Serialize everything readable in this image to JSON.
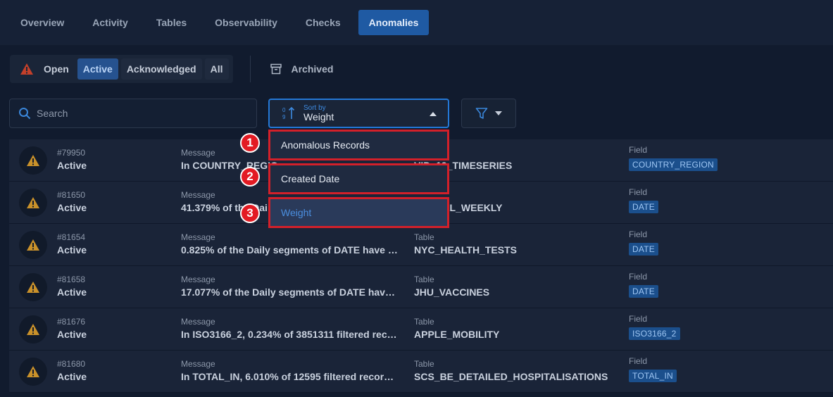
{
  "nav": {
    "tabs": [
      {
        "label": "Overview"
      },
      {
        "label": "Activity"
      },
      {
        "label": "Tables"
      },
      {
        "label": "Observability"
      },
      {
        "label": "Checks"
      },
      {
        "label": "Anomalies"
      }
    ],
    "active_tab": "Anomalies"
  },
  "filters": {
    "open_label": "Open",
    "active_label": "Active",
    "acknowledged_label": "Acknowledged",
    "all_label": "All",
    "archived_label": "Archived"
  },
  "search": {
    "placeholder": "Search"
  },
  "sort": {
    "caption": "Sort by",
    "value": "Weight",
    "options": [
      {
        "marker": "1",
        "label": "Anomalous Records"
      },
      {
        "marker": "2",
        "label": "Created Date"
      },
      {
        "marker": "3",
        "label": "Weight"
      }
    ]
  },
  "table": {
    "message_label": "Message",
    "table_label": "Table",
    "field_label": "Field",
    "rows": [
      {
        "id": "#79950",
        "status": "Active",
        "message": "In COUNTRY_REGIO",
        "table": "VID_19_TIMESERIES",
        "field": "COUNTRY_REGION"
      },
      {
        "id": "#81650",
        "status": "Active",
        "message": "41.379% of the Daily",
        "table": "GLOBAL_WEEKLY",
        "field": "DATE"
      },
      {
        "id": "#81654",
        "status": "Active",
        "message": "0.825% of the Daily segments of DATE have re...",
        "table": "NYC_HEALTH_TESTS",
        "field": "DATE"
      },
      {
        "id": "#81658",
        "status": "Active",
        "message": "17.077% of the Daily segments of DATE have r...",
        "table": "JHU_VACCINES",
        "field": "DATE"
      },
      {
        "id": "#81676",
        "status": "Active",
        "message": "In ISO3166_2, 0.234% of 3851311 filtered recor...",
        "table": "APPLE_MOBILITY",
        "field": "ISO3166_2"
      },
      {
        "id": "#81680",
        "status": "Active",
        "message": "In TOTAL_IN, 6.010% of 12595 filtered records...",
        "table": "SCS_BE_DETAILED_HOSPITALISATIONS",
        "field": "TOTAL_IN"
      }
    ]
  },
  "colors": {
    "accent": "#1f5aa3",
    "highlight": "#d3202a",
    "warning": "#c9912a"
  }
}
